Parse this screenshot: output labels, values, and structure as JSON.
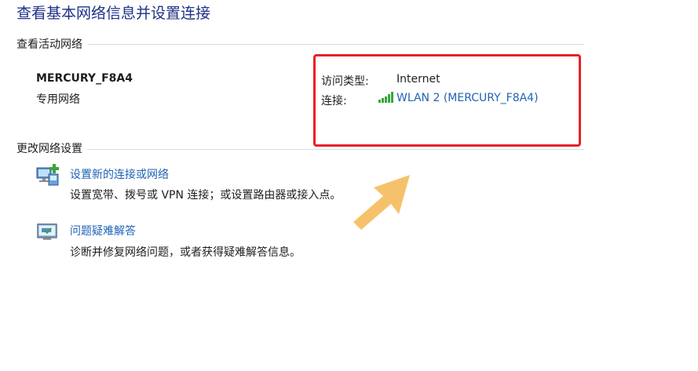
{
  "title": "查看基本网络信息并设置连接",
  "active_networks": {
    "section_label": "查看活动网络",
    "network_name": "MERCURY_F8A4",
    "network_type": "专用网络",
    "access_type_label": "访问类型:",
    "access_type_value": "Internet",
    "connection_label": "连接:",
    "connection_value": "WLAN 2 (MERCURY_F8A4)",
    "connection_icon": "wifi-signal-icon"
  },
  "change_settings": {
    "section_label": "更改网络设置",
    "tasks": [
      {
        "icon": "new-connection-icon",
        "link": "设置新的连接或网络",
        "desc": "设置宽带、拨号或 VPN 连接；或设置路由器或接入点。"
      },
      {
        "icon": "troubleshoot-icon",
        "link": "问题疑难解答",
        "desc": "诊断并修复网络问题，或者获得疑难解答信息。"
      }
    ]
  },
  "colors": {
    "title": "#1e3287",
    "link": "#1f63b5",
    "highlight": "#e8202a",
    "arrow": "#f5c26b"
  }
}
